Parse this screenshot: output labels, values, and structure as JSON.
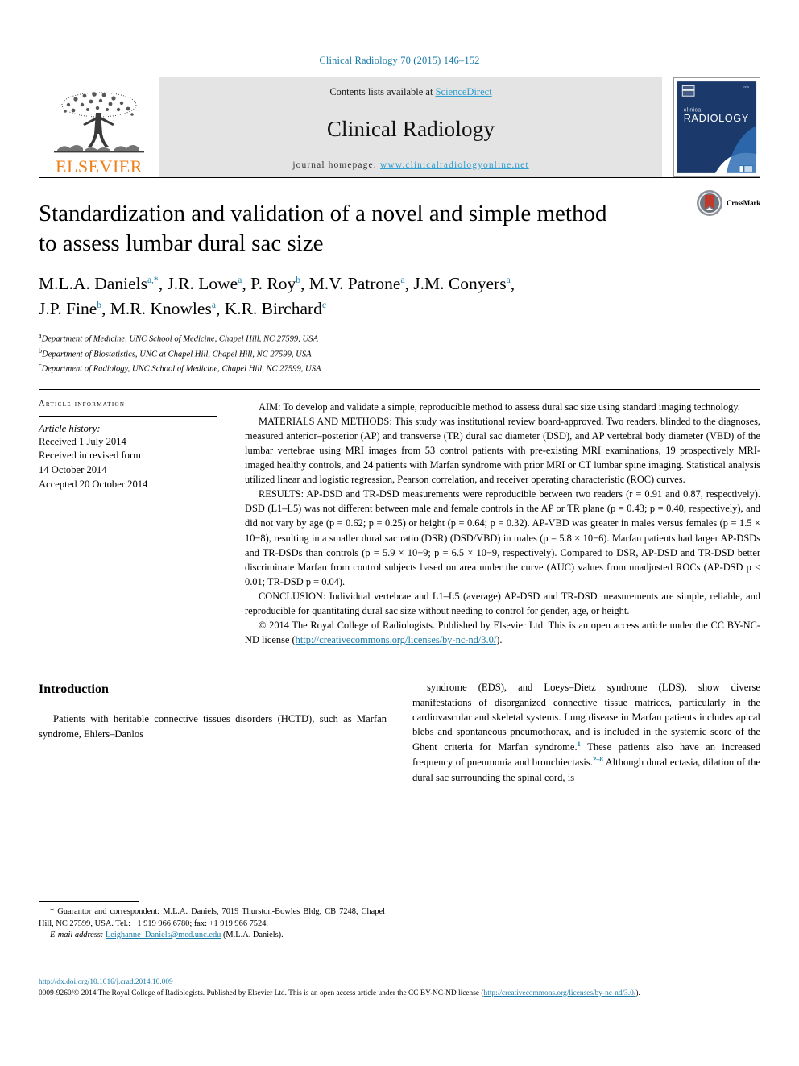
{
  "running_head": "Clinical Radiology 70 (2015) 146–152",
  "masthead": {
    "publisher_name": "ELSEVIER",
    "publisher_logo_icon": "elsevier-tree-logo",
    "contents_line_prefix": "Contents lists available at ",
    "contents_line_link": "ScienceDirect",
    "journal_name": "Clinical Radiology",
    "homepage_label": "journal homepage: ",
    "homepage_url": "www.clinicalradiologyonline.net",
    "cover_title_small": "clinical",
    "cover_title_large": "RADIOLOGY",
    "accent_color": "#2f9fd0",
    "elsevier_orange": "#ef7f1a",
    "cover_navy": "#1b3a6b"
  },
  "title": "Standardization and validation of a novel and simple method to assess lumbar dural sac size",
  "crossmark": {
    "label": "CrossMark",
    "icon": "crossmark-logo"
  },
  "authors": [
    {
      "name": "M.L.A. Daniels",
      "marks": "a,*"
    },
    {
      "name": "J.R. Lowe",
      "marks": "a"
    },
    {
      "name": "P. Roy",
      "marks": "b"
    },
    {
      "name": "M.V. Patrone",
      "marks": "a"
    },
    {
      "name": "J.M. Conyers",
      "marks": "a"
    },
    {
      "name": "J.P. Fine",
      "marks": "b"
    },
    {
      "name": "M.R. Knowles",
      "marks": "a"
    },
    {
      "name": "K.R. Birchard",
      "marks": "c"
    }
  ],
  "affiliations": [
    {
      "mark": "a",
      "text": "Department of Medicine, UNC School of Medicine, Chapel Hill, NC 27599, USA"
    },
    {
      "mark": "b",
      "text": "Department of Biostatistics, UNC at Chapel Hill, Chapel Hill, NC 27599, USA"
    },
    {
      "mark": "c",
      "text": "Department of Radiology, UNC School of Medicine, Chapel Hill, NC 27599, USA"
    }
  ],
  "article_info": {
    "heading": "ARTICLE INFORMATION",
    "history_label": "Article history:",
    "history_lines": [
      "Received 1 July 2014",
      "Received in revised form",
      "14 October 2014",
      "Accepted 20 October 2014"
    ]
  },
  "abstract": {
    "aim": "AIM: To develop and validate a simple, reproducible method to assess dural sac size using standard imaging technology.",
    "materials": "MATERIALS AND METHODS: This study was institutional review board-approved. Two readers, blinded to the diagnoses, measured anterior–posterior (AP) and transverse (TR) dural sac diameter (DSD), and AP vertebral body diameter (VBD) of the lumbar vertebrae using MRI images from 53 control patients with pre-existing MRI examinations, 19 prospectively MRI-imaged healthy controls, and 24 patients with Marfan syndrome with prior MRI or CT lumbar spine imaging. Statistical analysis utilized linear and logistic regression, Pearson correlation, and receiver operating characteristic (ROC) curves.",
    "results": "RESULTS: AP-DSD and TR-DSD measurements were reproducible between two readers (r = 0.91 and 0.87, respectively). DSD (L1–L5) was not different between male and female controls in the AP or TR plane (p = 0.43; p = 0.40, respectively), and did not vary by age (p = 0.62; p = 0.25) or height (p = 0.64; p = 0.32). AP-VBD was greater in males versus females (p = 1.5 × 10−8), resulting in a smaller dural sac ratio (DSR) (DSD/VBD) in males (p = 5.8 × 10−6). Marfan patients had larger AP-DSDs and TR-DSDs than controls (p = 5.9 × 10−9; p = 6.5 × 10−9, respectively). Compared to DSR, AP-DSD and TR-DSD better discriminate Marfan from control subjects based on area under the curve (AUC) values from unadjusted ROCs (AP-DSD p < 0.01; TR-DSD p = 0.04).",
    "conclusion": "CONCLUSION: Individual vertebrae and L1–L5 (average) AP-DSD and TR-DSD measurements are simple, reliable, and reproducible for quantitating dural sac size without needing to control for gender, age, or height.",
    "copyright_text": "© 2014 The Royal College of Radiologists. Published by Elsevier Ltd. This is an open access article under the CC BY-NC-ND license (",
    "copyright_link": "http://creativecommons.org/licenses/by-nc-nd/3.0/",
    "copyright_tail": ")."
  },
  "introduction": {
    "heading": "Introduction",
    "left_text": "Patients with heritable connective tissues disorders (HCTD), such as Marfan syndrome, Ehlers–Danlos",
    "right_part1": "syndrome (EDS), and Loeys–Dietz syndrome (LDS), show diverse manifestations of disorganized connective tissue matrices, particularly in the cardiovascular and skeletal systems. Lung disease in Marfan patients includes apical blebs and spontaneous pneumothorax, and is included in the systemic score of the Ghent criteria for Marfan syndrome.",
    "right_ref1": "1",
    "right_part2": " These patients also have an increased frequency of pneumonia and bronchiectasis.",
    "right_ref2": "2–8",
    "right_part3": " Although dural ectasia, dilation of the dural sac surrounding the spinal cord, is"
  },
  "footnote": {
    "guarantor": "* Guarantor and correspondent: M.L.A. Daniels, 7019 Thurston-Bowles Bldg, CB 7248, Chapel Hill, NC 27599, USA. Tel.: +1 919 966 6780; fax: +1 919 966 7524.",
    "email_label": "E-mail address:",
    "email": "Leighanne_Daniels@med.unc.edu",
    "email_suffix": "(M.L.A. Daniels)."
  },
  "footer": {
    "doi": "http://dx.doi.org/10.1016/j.crad.2014.10.009",
    "issn_copyright": "0009-9260/© 2014 The Royal College of Radiologists. Published by Elsevier Ltd. This is an open access article under the CC BY-NC-ND license (",
    "license_link_1": "http://creativecommons.org/",
    "license_link_2": "licenses/by-nc-nd/3.0/",
    "license_tail": ")."
  }
}
